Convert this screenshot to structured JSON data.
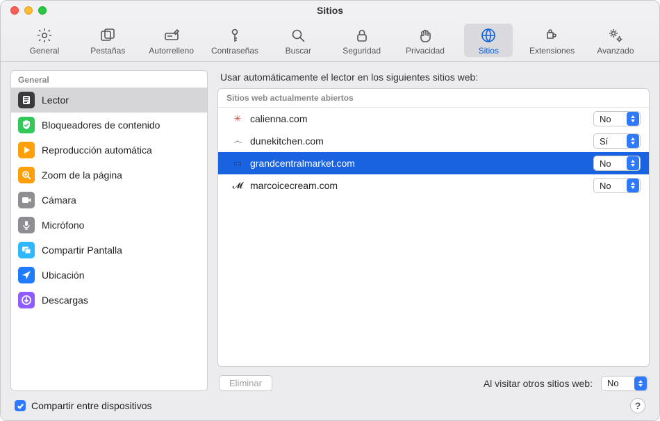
{
  "window_title": "Sitios",
  "toolbar": [
    {
      "id": "general",
      "label": "General",
      "icon": "gear"
    },
    {
      "id": "tabs",
      "label": "Pestañas",
      "icon": "tabs"
    },
    {
      "id": "autofill",
      "label": "Autorrelleno",
      "icon": "pencil-box"
    },
    {
      "id": "passwords",
      "label": "Contraseñas",
      "icon": "key"
    },
    {
      "id": "search",
      "label": "Buscar",
      "icon": "magnify"
    },
    {
      "id": "security",
      "label": "Seguridad",
      "icon": "lock"
    },
    {
      "id": "privacy",
      "label": "Privacidad",
      "icon": "hand"
    },
    {
      "id": "websites",
      "label": "Sitios",
      "icon": "globe",
      "active": true
    },
    {
      "id": "extensions",
      "label": "Extensiones",
      "icon": "puzzle"
    },
    {
      "id": "advanced",
      "label": "Avanzado",
      "icon": "gears"
    }
  ],
  "sidebar": {
    "header": "General",
    "items": [
      {
        "id": "reader",
        "label": "Lector",
        "icon_bg": "#3a3a3c",
        "glyph": "reader",
        "selected": true
      },
      {
        "id": "blockers",
        "label": "Bloqueadores de contenido",
        "icon_bg": "#32c85a",
        "glyph": "shield"
      },
      {
        "id": "autoplay",
        "label": "Reproducción automática",
        "icon_bg": "#ff9f0a",
        "glyph": "play"
      },
      {
        "id": "zoom",
        "label": "Zoom de la página",
        "icon_bg": "#ff9f0a",
        "glyph": "zoom"
      },
      {
        "id": "camera",
        "label": "Cámara",
        "icon_bg": "#8e8e93",
        "glyph": "camera"
      },
      {
        "id": "mic",
        "label": "Micrófono",
        "icon_bg": "#8e8e93",
        "glyph": "mic"
      },
      {
        "id": "screenshare",
        "label": "Compartir Pantalla",
        "icon_bg": "#2fb8ff",
        "glyph": "screens"
      },
      {
        "id": "location",
        "label": "Ubicación",
        "icon_bg": "#1f7bff",
        "glyph": "location"
      },
      {
        "id": "downloads",
        "label": "Descargas",
        "icon_bg": "#8e5cff",
        "glyph": "download"
      }
    ]
  },
  "detail": {
    "title": "Usar automáticamente el lector en los siguientes sitios web:",
    "list_header": "Sitios web actualmente abiertos",
    "rows": [
      {
        "domain": "calienna.com",
        "value": "No",
        "favicon": "✳",
        "fav_color": "#c64b38"
      },
      {
        "domain": "dunekitchen.com",
        "value": "Sí",
        "favicon": "෴",
        "fav_color": "#555"
      },
      {
        "domain": "grandcentralmarket.com",
        "value": "No",
        "favicon": "▭",
        "fav_color": "#2a3a6a",
        "selected": true
      },
      {
        "domain": "marcoicecream.com",
        "value": "No",
        "favicon": "𝓜",
        "fav_color": "#111"
      }
    ],
    "remove_label": "Eliminar",
    "visiting_label": "Al visitar otros sitios web:",
    "visiting_value": "No"
  },
  "footer": {
    "share_label": "Compartir entre dispositivos",
    "share_checked": true,
    "help_label": "?"
  }
}
